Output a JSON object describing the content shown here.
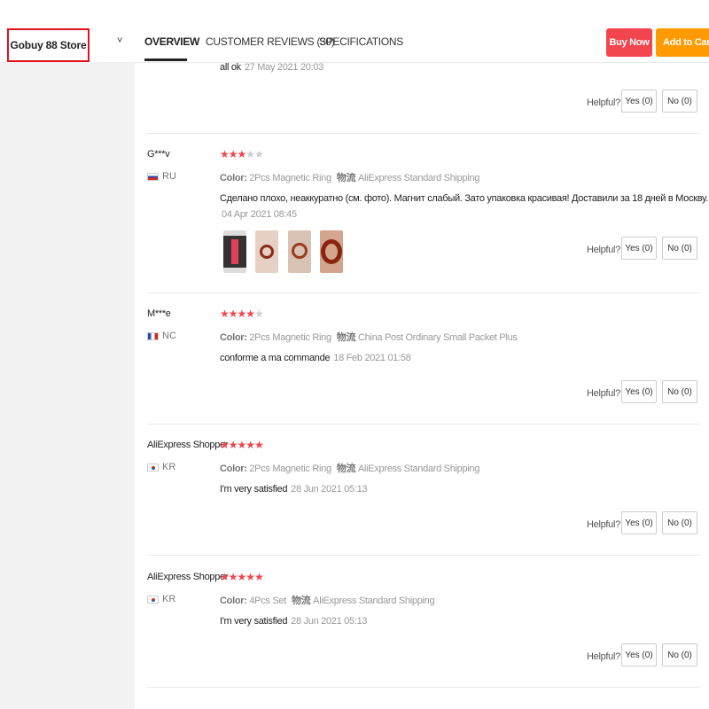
{
  "store": {
    "name": "Gobuy 88 Store",
    "chevron": "˅"
  },
  "tabs": [
    {
      "label": "OVERVIEW"
    },
    {
      "label": "CUSTOMER REVIEWS (30)"
    },
    {
      "label": "SPECIFICATIONS"
    }
  ],
  "actions": {
    "buy_now": "Buy Now",
    "add_to_cart": "Add to Cart"
  },
  "labels": {
    "color": "Color:",
    "shipping": "物流",
    "helpful": "Helpful?",
    "yes": "Yes (0)",
    "no": "No (0)"
  },
  "reviews": [
    {
      "text": "all ok",
      "date": "27 May 2021 20:03"
    },
    {
      "name": "G***v",
      "country": "RU",
      "stars": 3,
      "color": "2Pcs Magnetic Ring",
      "shipping": "AliExpress Standard Shipping",
      "text": "Сделано плохо, неаккуратно (см. фото). Магнит слабый. Зато упаковка красивая! Доставили за 18 дней в Москву.",
      "date": "04 Apr 2021 08:45",
      "photos": 4
    },
    {
      "name": "M***e",
      "country": "NC",
      "stars": 4,
      "color": "2Pcs Magnetic Ring",
      "shipping": "China Post Ordinary Small Packet Plus",
      "text": "conforme a ma commande",
      "date": "18 Feb 2021 01:58"
    },
    {
      "name": "AliExpress Shopper",
      "country": "KR",
      "stars": 5,
      "color": "2Pcs Magnetic Ring",
      "shipping": "AliExpress Standard Shipping",
      "text": "I'm very satisfied",
      "date": "28 Jun 2021 05:13"
    },
    {
      "name": "AliExpress Shopper",
      "country": "KR",
      "stars": 5,
      "color": "4Pcs Set",
      "shipping": "AliExpress Standard Shipping",
      "text": "I'm very satisfied",
      "date": "28 Jun 2021 05:13"
    }
  ],
  "colors": {
    "accent_red": "#f2454e",
    "accent_orange": "#ff9a00",
    "star_on": "#f2454e",
    "star_off": "#cccccc"
  },
  "icons": {
    "star": "star-icon",
    "flag_ru": "flag-ru-icon",
    "flag_fr": "flag-fr-icon",
    "flag_kr": "flag-kr-icon"
  }
}
